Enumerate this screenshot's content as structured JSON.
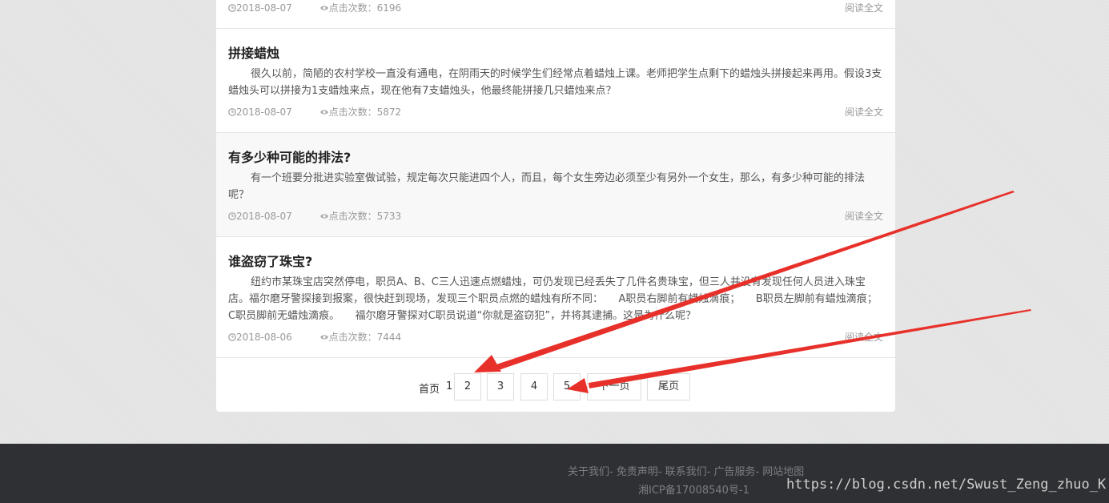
{
  "articles": [
    {
      "title": "",
      "excerpt": "",
      "date": "2018-08-07",
      "views_label": "点击次数：6196",
      "read_more": "阅读全文"
    },
    {
      "title": "拼接蜡烛",
      "excerpt": "很久以前，简陋的农村学校一直没有通电，在阴雨天的时候学生们经常点着蜡烛上课。老师把学生点剩下的蜡烛头拼接起来再用。假设3支蜡烛头可以拼接为1支蜡烛来点，现在他有7支蜡烛头，他最终能拼接几只蜡烛来点？",
      "date": "2018-08-07",
      "views_label": "点击次数：5872",
      "read_more": "阅读全文"
    },
    {
      "title": "有多少种可能的排法?",
      "excerpt": "有一个班要分批进实验室做试验，规定每次只能进四个人，而且，每个女生旁边必须至少有另外一个女生，那么，有多少种可能的排法呢？",
      "date": "2018-08-07",
      "views_label": "点击次数：5733",
      "read_more": "阅读全文"
    },
    {
      "title": "谁盗窃了珠宝?",
      "excerpt": "纽约市某珠宝店突然停电，职员A、B、C三人迅速点燃蜡烛，可仍发现已经丢失了几件名贵珠宝，但三人并没有发现任何人员进入珠宝店。福尔磨牙警探接到报案，很快赶到现场，发现三个职员点燃的蜡烛有所不同：　　A职员右脚前有蜡烛滴痕；　　B职员左脚前有蜡烛滴痕；　　C职员脚前无蜡烛滴痕。　　福尔磨牙警探对C职员说道“你就是盗窃犯”，并将其逮捕。这是为什么呢？",
      "date": "2018-08-06",
      "views_label": "点击次数：7444",
      "read_more": "阅读全文"
    }
  ],
  "pagination": {
    "first": "首页",
    "current": "1",
    "pages": [
      "2",
      "3",
      "4",
      "5"
    ],
    "next": "下一页",
    "last": "尾页"
  },
  "footer": {
    "links": "关于我们- 免责声明- 联系我们- 广告服务- 网站地图",
    "icp": "湘ICP备17008540号-1"
  },
  "watermark": "https://blog.csdn.net/Swust_Zeng_zhuo_K",
  "colors": {
    "annotation_arrow": "#e8302a",
    "footer_bg": "#2f3033",
    "page_bg": "#e3e3e3"
  },
  "icons": {
    "date": "clock-icon",
    "views": "eye-icon"
  }
}
